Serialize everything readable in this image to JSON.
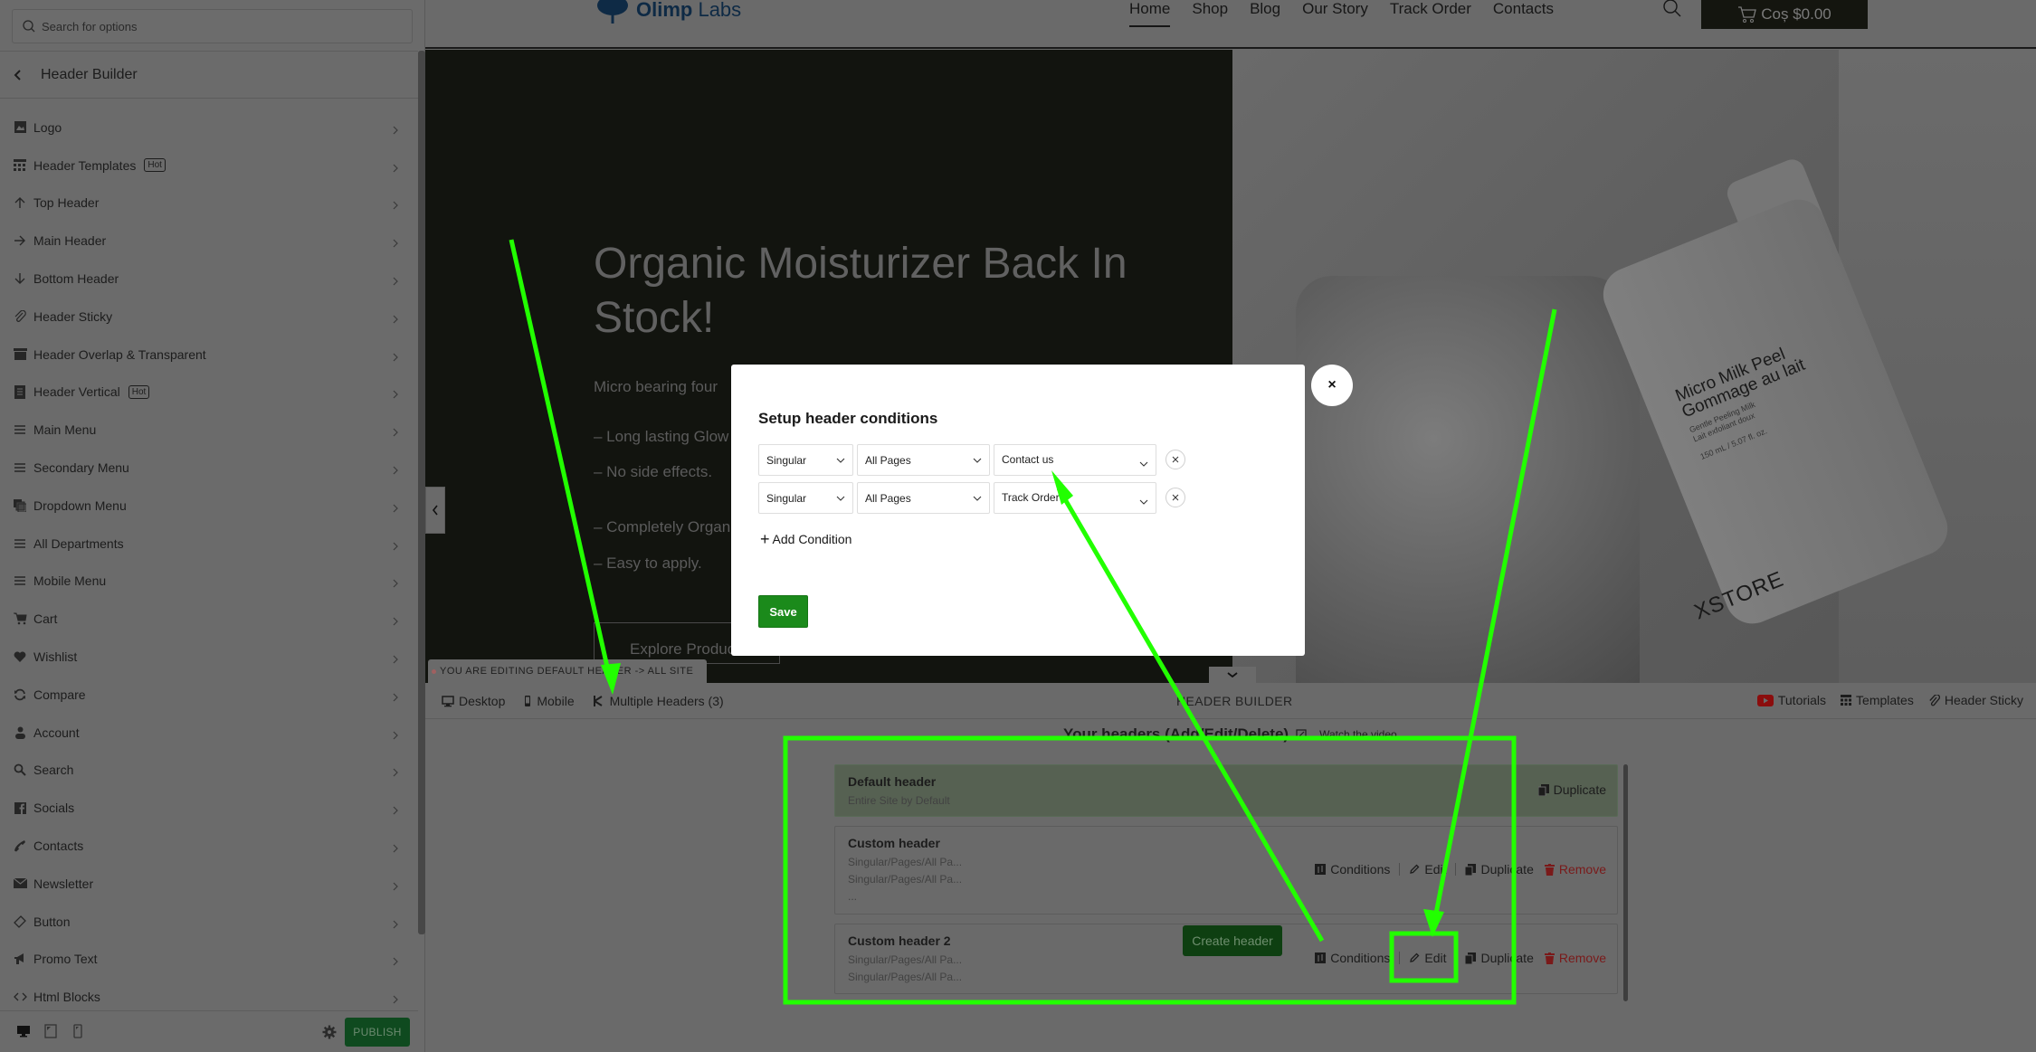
{
  "sidebar": {
    "search_placeholder": "Search for options",
    "title": "Header Builder",
    "items": [
      {
        "label": "Logo",
        "icon": "image-icon"
      },
      {
        "label": "Header Templates",
        "icon": "templates-icon",
        "badge": "Hot"
      },
      {
        "label": "Top Header",
        "icon": "arrow-up-icon"
      },
      {
        "label": "Main Header",
        "icon": "arrow-right-icon"
      },
      {
        "label": "Bottom Header",
        "icon": "arrow-down-icon"
      },
      {
        "label": "Header Sticky",
        "icon": "paperclip-icon"
      },
      {
        "label": "Header Overlap & Transparent",
        "icon": "archive-icon"
      },
      {
        "label": "Header Vertical",
        "icon": "document-icon",
        "badge": "Hot"
      },
      {
        "label": "Main Menu",
        "icon": "menu-icon"
      },
      {
        "label": "Secondary Menu",
        "icon": "menu-icon"
      },
      {
        "label": "Dropdown Menu",
        "icon": "layers-icon"
      },
      {
        "label": "All Departments",
        "icon": "menu-icon"
      },
      {
        "label": "Mobile Menu",
        "icon": "menu-icon"
      },
      {
        "label": "Cart",
        "icon": "cart-icon"
      },
      {
        "label": "Wishlist",
        "icon": "heart-icon"
      },
      {
        "label": "Compare",
        "icon": "refresh-icon"
      },
      {
        "label": "Account",
        "icon": "user-icon"
      },
      {
        "label": "Search",
        "icon": "search-icon"
      },
      {
        "label": "Socials",
        "icon": "facebook-icon"
      },
      {
        "label": "Contacts",
        "icon": "phone-icon"
      },
      {
        "label": "Newsletter",
        "icon": "envelope-icon"
      },
      {
        "label": "Button",
        "icon": "tag-icon"
      },
      {
        "label": "Promo Text",
        "icon": "megaphone-icon"
      },
      {
        "label": "Html Blocks",
        "icon": "code-icon"
      }
    ],
    "footer": {
      "publish_label": "PUBLISH"
    }
  },
  "site": {
    "logo_text_bold": "Olimp",
    "logo_text_light": " Labs",
    "nav": [
      "Home",
      "Shop",
      "Blog",
      "Our Story",
      "Track Order",
      "Contacts"
    ],
    "nav_active": "Home",
    "cart_label": "Coș $0.00",
    "hero": {
      "title": "Organic Moisturizer Back In Stock!",
      "subtitle": "Micro bearing four",
      "bullets": [
        "– Long lasting Glow",
        "– No side effects.",
        "– Completely Organ",
        "– Easy to apply."
      ],
      "cta": "Explore Produc"
    },
    "product": {
      "name_line1": "Micro Milk Peel",
      "name_line2": "Gommage au lait",
      "desc_line1": "Gentle Peeling Milk",
      "desc_line2": "Lait exfoliant doux",
      "volume": "150 mL / 5.07 fl. oz.",
      "brand": "XSTORE"
    }
  },
  "editing_notice": "YOU ARE EDITING DEFAULT HEADER -> ALL SITE",
  "builder": {
    "toolbar": {
      "desktop": "Desktop",
      "mobile": "Mobile",
      "multiple_headers": "Multiple Headers (3)",
      "center_title": "HEADER BUILDER",
      "tutorials": "Tutorials",
      "templates": "Templates",
      "header_sticky": "Header Sticky"
    },
    "headers_title": "Your headers (Add/Edit/Delete)",
    "watch_video": "Watch the video.",
    "headers": [
      {
        "name": "Default header",
        "conditions": [
          "Entire Site by Default"
        ],
        "actions": [
          "Duplicate"
        ]
      },
      {
        "name": "Custom header",
        "conditions": [
          "Singular/Pages/All Pa...",
          "Singular/Pages/All Pa...",
          "..."
        ],
        "actions": [
          "Conditions",
          "Edit",
          "Duplicate",
          "Remove"
        ]
      },
      {
        "name": "Custom header 2",
        "conditions": [
          "Singular/Pages/All Pa...",
          "Singular/Pages/All Pa..."
        ],
        "actions": [
          "Conditions",
          "Edit",
          "Duplicate",
          "Remove"
        ]
      }
    ],
    "create_label": "Create header"
  },
  "modal": {
    "title": "Setup header conditions",
    "conditions": [
      {
        "type": "Singular",
        "scope": "All Pages",
        "page": "Contact us"
      },
      {
        "type": "Singular",
        "scope": "All Pages",
        "page": "Track Order"
      }
    ],
    "add_label": "Add Condition",
    "save_label": "Save",
    "close_label": "×"
  },
  "colors": {
    "annotation": "#22ff00",
    "save": "#1b8a1b",
    "remove": "#7a1a1a",
    "youtube": "#8b0d0d"
  }
}
